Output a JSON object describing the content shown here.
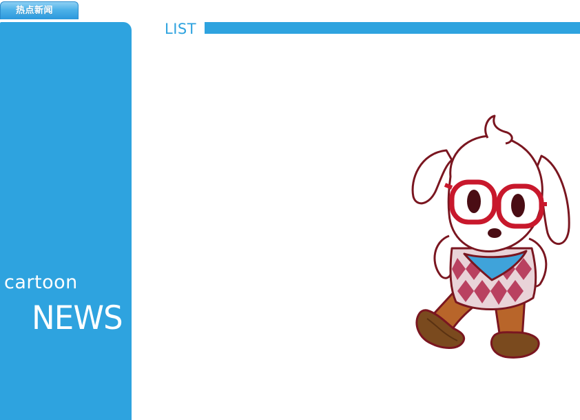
{
  "header": {
    "tab_label": "热点新闻"
  },
  "sidebar": {
    "brand_small": "cartoon",
    "brand_big": "NEWS"
  },
  "main": {
    "section_label": "LIST"
  },
  "colors": {
    "brand_blue": "#2ea3df",
    "background": "#ffffff"
  },
  "illustration": {
    "subject": "cartoon dog mascot with red glasses and argyle vest"
  }
}
